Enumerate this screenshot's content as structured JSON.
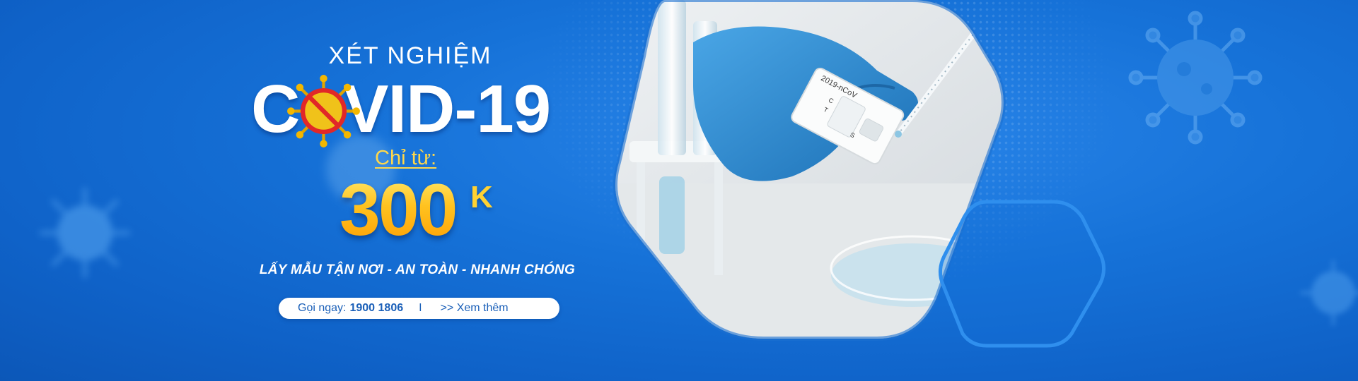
{
  "banner": {
    "headline_top": "XÉT NGHIỆM",
    "title_c": "C",
    "title_rest": "VID-19",
    "from_label": "Chỉ từ:",
    "price": "300",
    "price_unit": "K",
    "tagline": "LẤY MẪU TẬN NƠI - AN TOÀN - NHANH CHÓNG",
    "cta": {
      "call_label": "Gọi ngay:",
      "phone": "1900 1806",
      "separator": "I",
      "more_link": ">> Xem thêm"
    },
    "hero": {
      "test_cassette_text": "2019-nCoV",
      "cassette_marks": [
        "C",
        "T",
        "S"
      ]
    }
  },
  "colors": {
    "background": "#1672d8",
    "price_gold": "#ffc21f",
    "from_label": "#ffd84a",
    "cta_text": "#1a5fb8",
    "glove_blue": "#2b8fd8"
  },
  "icons": [
    "covid-virus-icon",
    "virus-background-icon",
    "world-map-dots"
  ]
}
